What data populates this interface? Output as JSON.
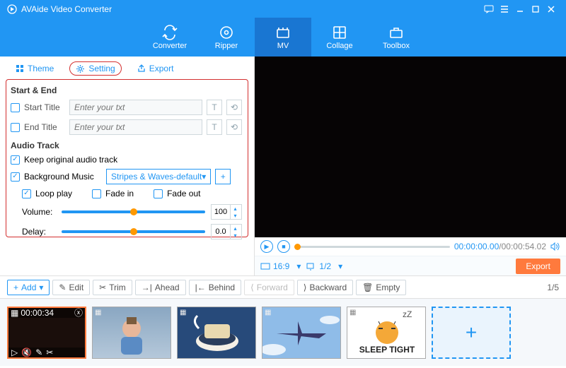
{
  "app": {
    "title": "AVAide Video Converter"
  },
  "window_buttons": {
    "feedback": "feedback",
    "menu": "menu",
    "min": "minimize",
    "max": "maximize",
    "close": "close"
  },
  "toolbar": [
    {
      "id": "converter",
      "label": "Converter"
    },
    {
      "id": "ripper",
      "label": "Ripper"
    },
    {
      "id": "mv",
      "label": "MV",
      "active": true
    },
    {
      "id": "collage",
      "label": "Collage"
    },
    {
      "id": "toolbox",
      "label": "Toolbox"
    }
  ],
  "tabs": [
    {
      "id": "theme",
      "label": "Theme"
    },
    {
      "id": "setting",
      "label": "Setting",
      "selected": true
    },
    {
      "id": "export",
      "label": "Export"
    }
  ],
  "start_end": {
    "title": "Start & End",
    "start": {
      "label": "Start Title",
      "placeholder": "Enter your txt",
      "checked": false
    },
    "end": {
      "label": "End Title",
      "placeholder": "Enter your txt",
      "checked": false
    }
  },
  "audio": {
    "title": "Audio Track",
    "keep": {
      "label": "Keep original audio track",
      "checked": true
    },
    "bgm": {
      "label": "Background Music",
      "checked": true,
      "value": "Stripes & Waves-default"
    },
    "loop": {
      "label": "Loop play",
      "checked": true
    },
    "fadein": {
      "label": "Fade in",
      "checked": false
    },
    "fadeout": {
      "label": "Fade out",
      "checked": false
    },
    "volume": {
      "label": "Volume:",
      "value": "100",
      "pos": 100
    },
    "delay": {
      "label": "Delay:",
      "value": "0.0",
      "pos": 100
    }
  },
  "player": {
    "current": "00:00:00.00",
    "total": "00:00:54.02",
    "aspect": "16:9",
    "screens": "1/2"
  },
  "export_btn": "Export",
  "actions": {
    "add": "Add",
    "edit": "Edit",
    "trim": "Trim",
    "ahead": "Ahead",
    "behind": "Behind",
    "forward": "Forward",
    "backward": "Backward",
    "empty": "Empty"
  },
  "pager": "1/5",
  "thumbs": [
    {
      "id": 1,
      "duration": "00:00:34",
      "selected": true,
      "bg": "#1a0e0b"
    },
    {
      "id": 2,
      "bg": "#8aa7c2"
    },
    {
      "id": 3,
      "bg": "#274a7a"
    },
    {
      "id": 4,
      "bg": "#8fbce8"
    },
    {
      "id": 5,
      "bg": "#fff"
    }
  ]
}
